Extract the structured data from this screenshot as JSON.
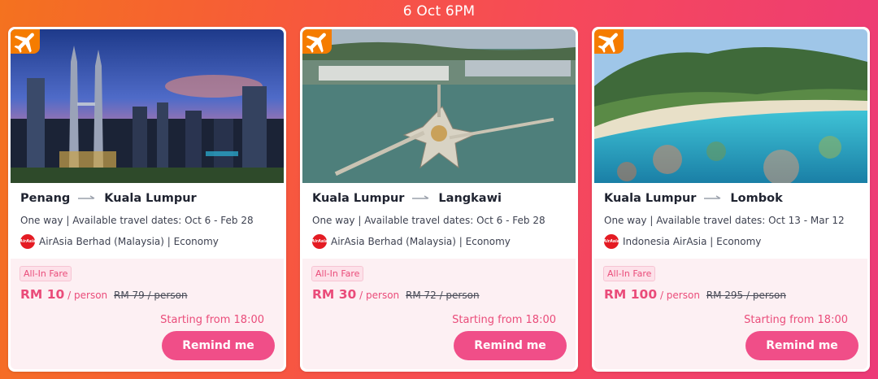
{
  "header": {
    "time_label": "6 Oct 6PM"
  },
  "colors": {
    "accent": "#f04e88",
    "badge": "#f57c00",
    "fare_panel": "#fdf0f3"
  },
  "icons": {
    "badge": "airplane-icon",
    "route": "arrow-right-icon",
    "airline": "airasia-logo"
  },
  "cards": [
    {
      "origin": "Penang",
      "destination": "Kuala Lumpur",
      "meta": "One way | Available travel dates: Oct 6 - Feb 28",
      "airline": "AirAsia Berhad (Malaysia) | Economy",
      "fare_tag": "All-In Fare",
      "price": "RM 10",
      "per_person": "/ person",
      "old_price": "RM 79 / person",
      "starting": "Starting from 18:00",
      "remind_label": "Remind me"
    },
    {
      "origin": "Kuala Lumpur",
      "destination": "Langkawi",
      "meta": "One way | Available travel dates: Oct 6 - Feb 28",
      "airline": "AirAsia Berhad (Malaysia) | Economy",
      "fare_tag": "All-In Fare",
      "price": "RM 30",
      "per_person": "/ person",
      "old_price": "RM 72 / person",
      "starting": "Starting from 18:00",
      "remind_label": "Remind me"
    },
    {
      "origin": "Kuala Lumpur",
      "destination": "Lombok",
      "meta": "One way | Available travel dates: Oct 13 - Mar 12",
      "airline": "Indonesia AirAsia | Economy",
      "fare_tag": "All-In Fare",
      "price": "RM 100",
      "per_person": "/ person",
      "old_price": "RM 295 / person",
      "starting": "Starting from 18:00",
      "remind_label": "Remind me"
    }
  ]
}
